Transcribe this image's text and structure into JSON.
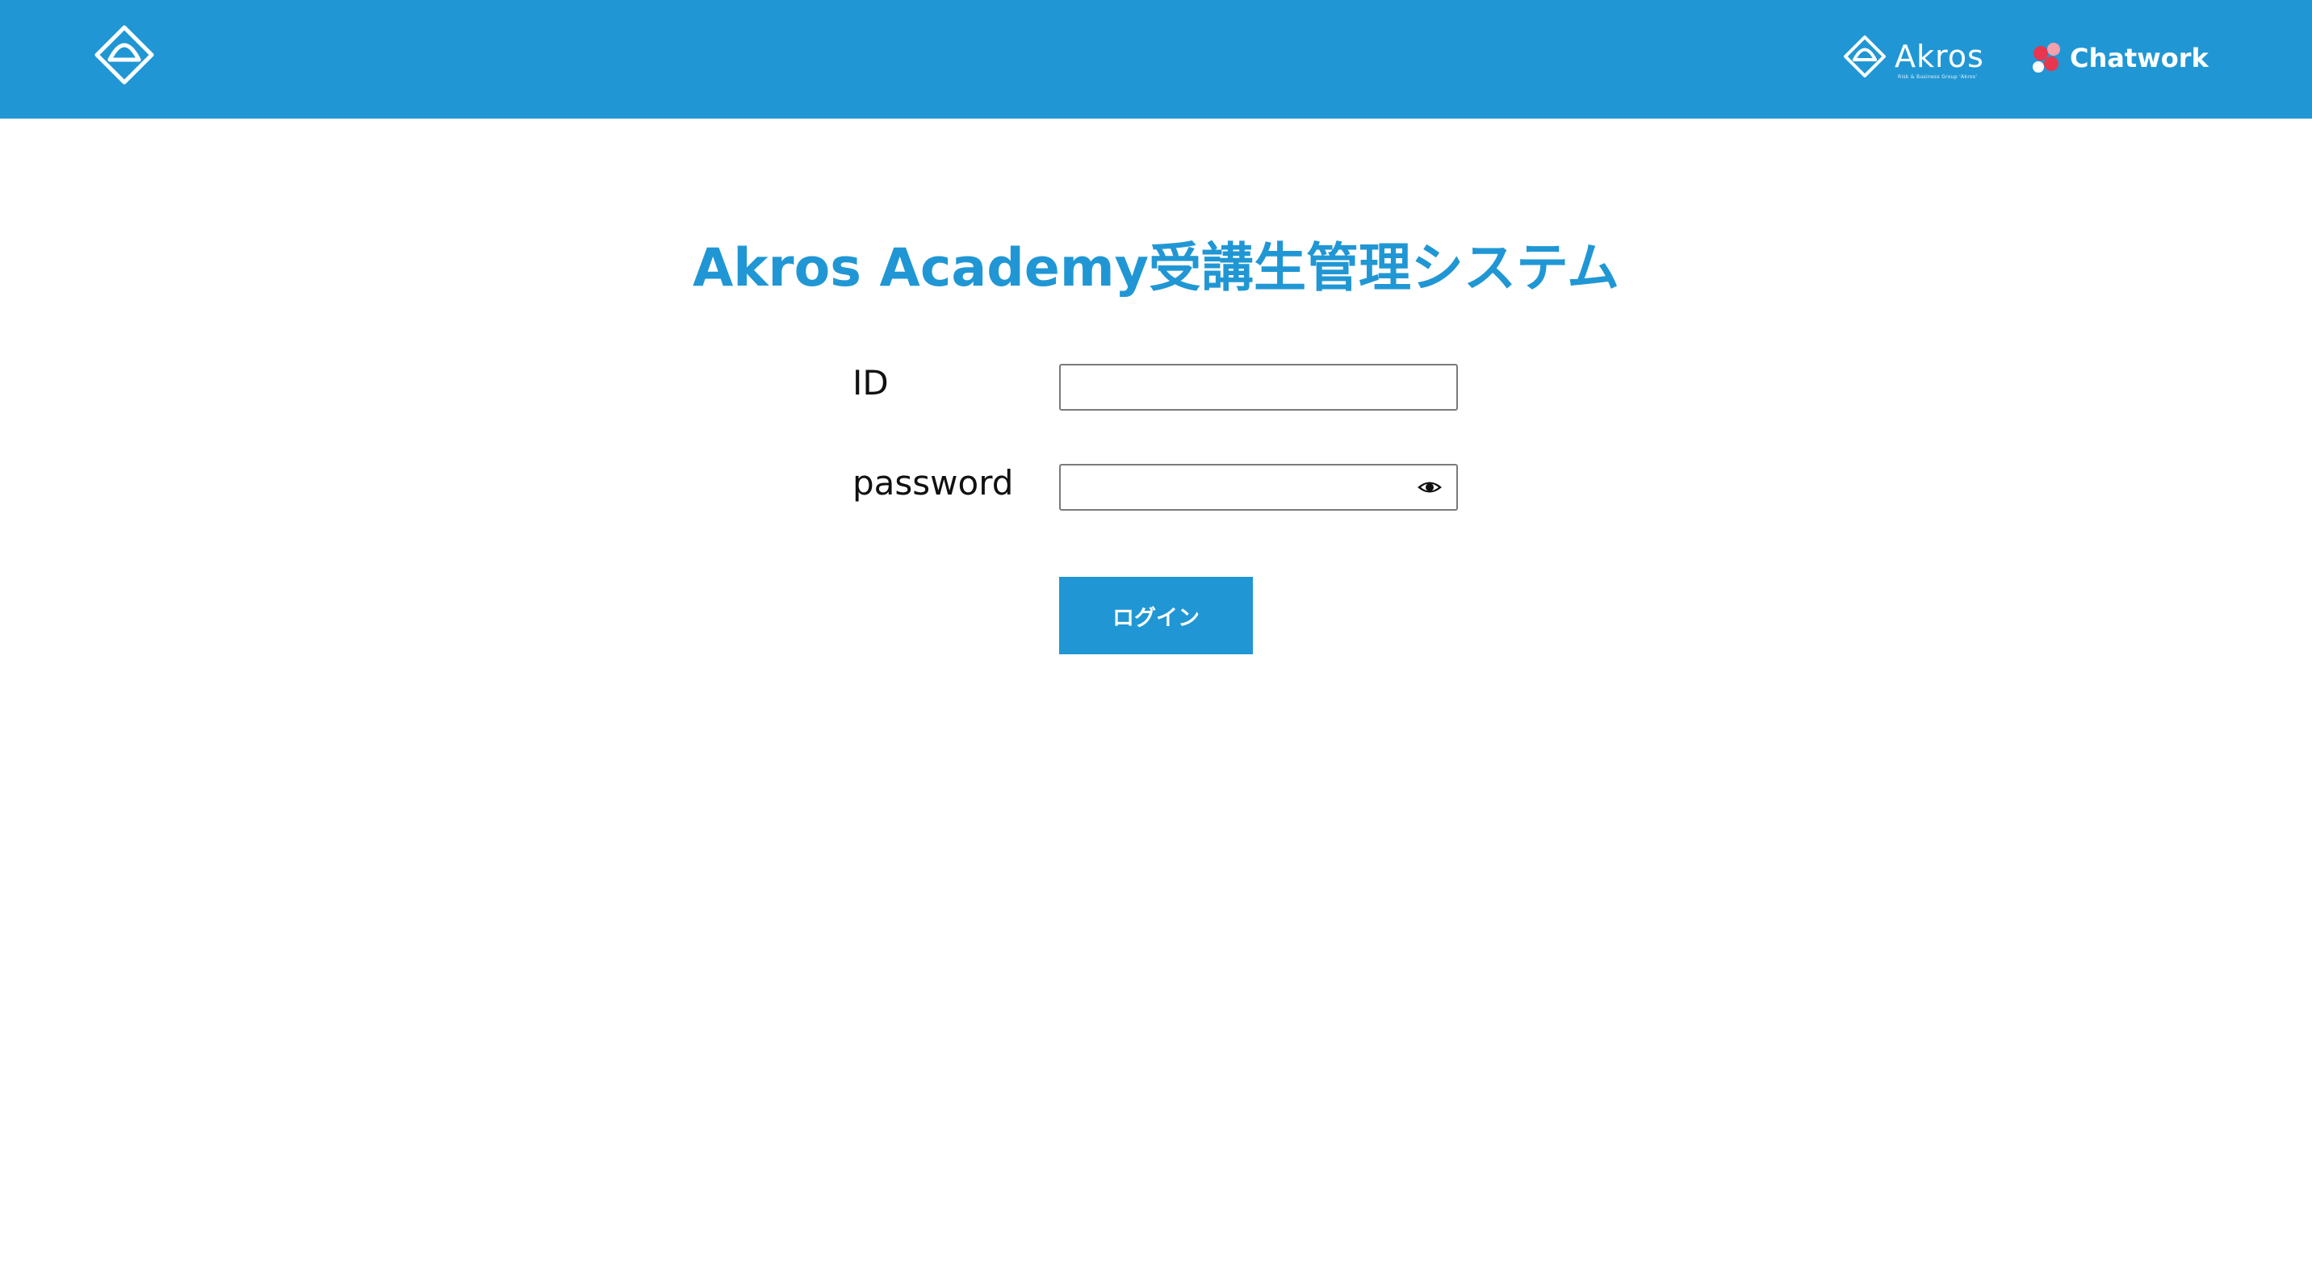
{
  "header": {
    "background_color": "#2097d4",
    "logo_icon": "akros-diamond-logo-icon",
    "partners": {
      "akros": {
        "icon": "akros-diamond-logo-icon",
        "name": "Akros",
        "tagline": "Risk & Business Group 'Akros'"
      },
      "chatwork": {
        "icon": "chatwork-logo-icon",
        "name": "Chatwork"
      }
    }
  },
  "main": {
    "title": "Akros Academy受講生管理システム",
    "title_color": "#2097d4",
    "form": {
      "id_label": "ID",
      "id_value": "",
      "password_label": "password",
      "password_value": "",
      "password_toggle_icon": "eye-icon",
      "login_button_label": "ログイン",
      "button_color": "#2097d4"
    }
  }
}
